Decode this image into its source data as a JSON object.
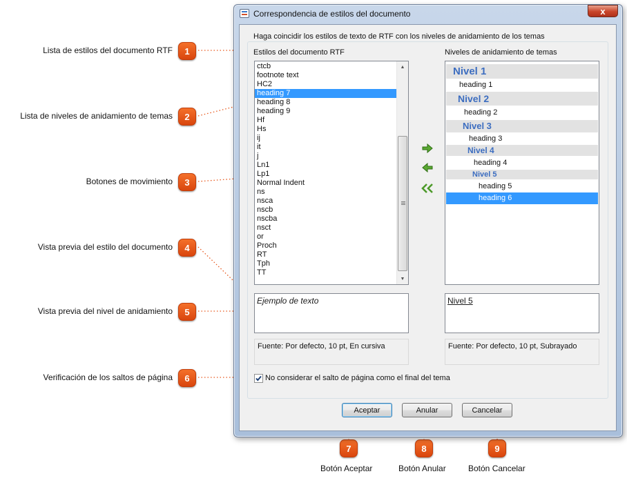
{
  "callouts": [
    {
      "num": "1",
      "label": "Lista de estilos del documento RTF"
    },
    {
      "num": "2",
      "label": "Lista de niveles de anidamiento de temas"
    },
    {
      "num": "3",
      "label": "Botones de movimiento"
    },
    {
      "num": "4",
      "label": "Vista previa del estilo del documento"
    },
    {
      "num": "5",
      "label": "Vista previa del nivel de anidamiento"
    },
    {
      "num": "6",
      "label": "Verificación de los saltos de página"
    },
    {
      "num": "7",
      "label": "Botón Aceptar"
    },
    {
      "num": "8",
      "label": "Botón Anular"
    },
    {
      "num": "9",
      "label": "Botón Cancelar"
    }
  ],
  "dialog": {
    "title": "Correspondencia de estilos del documento",
    "close_glyph": "x",
    "group_caption": "Haga coincidir los estilos de texto de RTF con los niveles de anidamiento de los temas",
    "rtf_list_label": "Estilos del documento RTF",
    "nesting_list_label": "Niveles de anidamiento de temas",
    "rtf_styles": [
      "ctcb",
      "footnote text",
      "HC2",
      "heading 7",
      "heading 8",
      "heading 9",
      "Hf",
      "Hs",
      "ij",
      "it",
      "j",
      "Ln1",
      "Lp1",
      "Normal Indent",
      "ns",
      "nsca",
      "nscb",
      "nscba",
      "nsct",
      "or",
      "Proch",
      "RT",
      "Tph",
      "TT"
    ],
    "rtf_selected_index": 3,
    "nesting_levels": [
      {
        "text": "Nivel 1",
        "kind": "level"
      },
      {
        "text": "heading 1",
        "kind": "heading"
      },
      {
        "text": "Nivel 2",
        "kind": "level"
      },
      {
        "text": "heading 2",
        "kind": "heading"
      },
      {
        "text": "Nivel 3",
        "kind": "level"
      },
      {
        "text": "heading 3",
        "kind": "heading"
      },
      {
        "text": "Nivel 4",
        "kind": "level"
      },
      {
        "text": "heading 4",
        "kind": "heading"
      },
      {
        "text": "Nivel 5",
        "kind": "level"
      },
      {
        "text": "heading 5",
        "kind": "heading"
      },
      {
        "text": "heading 6",
        "kind": "heading",
        "selected": true
      }
    ],
    "style_preview_text": "Ejemplo de texto",
    "level_preview_text": "Nivel 5",
    "style_font_info": "Fuente: Por defecto, 10 pt, En cursiva",
    "level_font_info": "Fuente: Por defecto, 10 pt, Subrayado",
    "page_break_checkbox": {
      "label": "No considerar el salto de página como el final del tema",
      "checked": true
    },
    "buttons": {
      "ok": "Aceptar",
      "reset": "Anular",
      "cancel": "Cancelar"
    }
  },
  "colors": {
    "accent": "#3399ff",
    "level_text": "#3c6dc0",
    "badge": "#e8561a",
    "arrow_green": "#4d9a2a"
  }
}
